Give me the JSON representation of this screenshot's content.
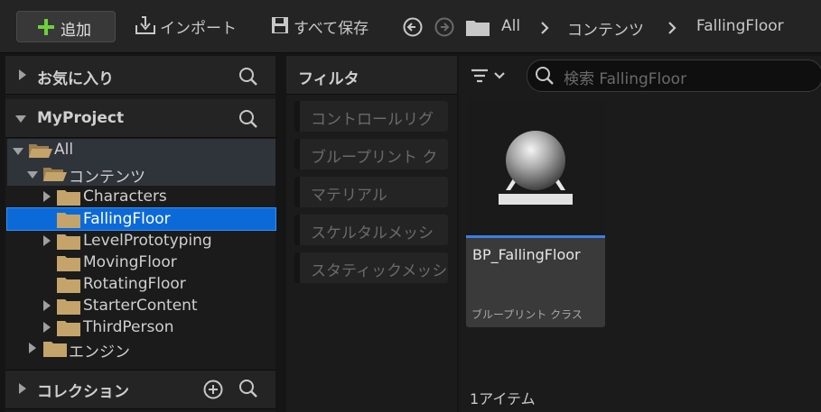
{
  "toolbar": {
    "add_label": "追加",
    "import_label": "インポート",
    "save_all_label": "すべて保存",
    "breadcrumb": [
      "All",
      "コンテンツ",
      "FallingFloor"
    ]
  },
  "favorites": {
    "title": "お気に入り"
  },
  "project": {
    "title": "MyProject"
  },
  "tree": {
    "items": [
      {
        "label": "All"
      },
      {
        "label": "コンテンツ"
      },
      {
        "label": "Characters"
      },
      {
        "label": "FallingFloor"
      },
      {
        "label": "LevelPrototyping"
      },
      {
        "label": "MovingFloor"
      },
      {
        "label": "RotatingFloor"
      },
      {
        "label": "StarterContent"
      },
      {
        "label": "ThirdPerson"
      },
      {
        "label": "エンジン"
      }
    ]
  },
  "collections": {
    "title": "コレクション"
  },
  "filters": {
    "title": "フィルタ",
    "items": [
      "コントロールリグ",
      "ブループリント ク",
      "マテリアル",
      "スケルタルメッシ",
      "スタティックメッシ"
    ]
  },
  "content": {
    "search_placeholder": "検索 FallingFloor",
    "asset": {
      "name": "BP_FallingFloor",
      "type": "ブループリント クラス"
    },
    "item_count": "1アイテム"
  },
  "colors": {
    "selection": "#0c6ad8",
    "add_plus": "#6fcf3b",
    "folder": "#c4a46a",
    "asset_underline": "#3d7fe6"
  }
}
